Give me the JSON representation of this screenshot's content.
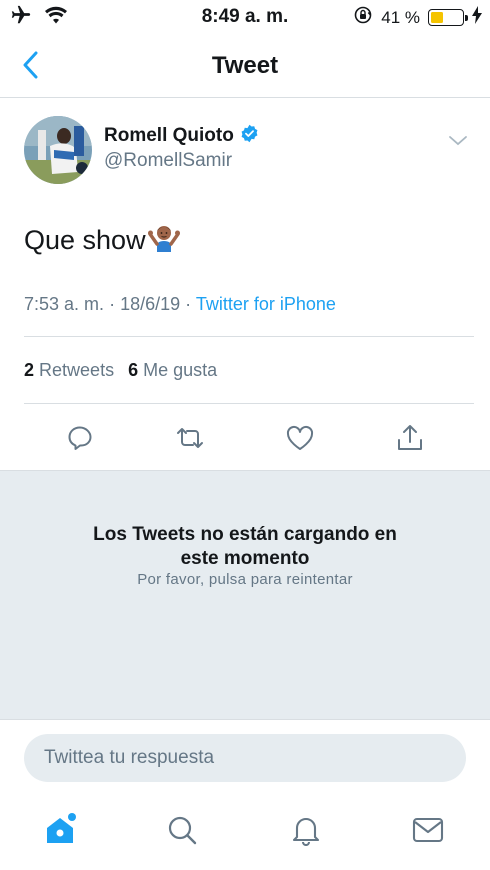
{
  "status_bar": {
    "time": "8:49 a. m.",
    "battery_percent_text": "41 %",
    "battery_level": 0.41
  },
  "header": {
    "title": "Tweet"
  },
  "tweet": {
    "author_name": "Romell Quioto",
    "author_handle": "@RomellSamir",
    "verified": true,
    "text": "Que show",
    "text_emoji": "man-shrugging",
    "time": "7:53 a. m.",
    "date": "18/6/19",
    "separator": "·",
    "source": "Twitter for iPhone",
    "retweets_count": "2",
    "retweets_label": "Retweets",
    "likes_count": "6",
    "likes_label": "Me gusta"
  },
  "error": {
    "title": "Los Tweets no están cargando en este momento",
    "subtitle": "Por favor, pulsa para reintentar"
  },
  "reply": {
    "placeholder": "Twittea tu respuesta"
  },
  "colors": {
    "accent": "#1da1f2",
    "secondary_text": "#657786",
    "panel_bg": "#e6ecf0",
    "battery": "#f5c400"
  }
}
